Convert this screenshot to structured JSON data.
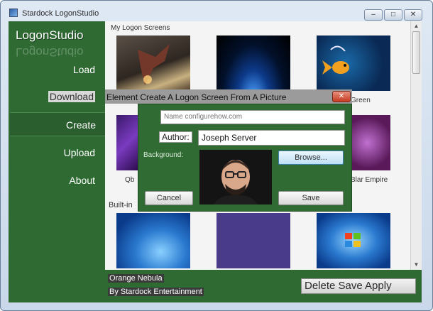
{
  "window": {
    "title": "Stardock LogonStudio",
    "controls": {
      "minimize": "–",
      "maximize": "□",
      "close": "✕"
    }
  },
  "sidebar": {
    "brand": "LogonStudio",
    "items": [
      {
        "label": "Load"
      },
      {
        "label": "Download"
      },
      {
        "label": "Create"
      },
      {
        "label": "Upload"
      },
      {
        "label": "About"
      }
    ]
  },
  "main": {
    "my_screens_label": "My Logon Screens",
    "built_in_label": "Built-in",
    "captions": {
      "green": "Green",
      "qbyte": "Qb",
      "empire": "Blar Empire"
    }
  },
  "bottom": {
    "theme_name": "Orange Nebula",
    "theme_author": "By Stardock Entertainment",
    "actions": "Delete Save Apply"
  },
  "dialog": {
    "title": "Element Create A Logon Screen From A Picture",
    "close": "✕",
    "name_placeholder": "Name configurehow.com",
    "author_label": "Author:",
    "author_value": "Joseph Server",
    "background_label": "Background:",
    "browse_label": "Browse...",
    "cancel_label": "Cancel",
    "save_label": "Save"
  },
  "colors": {
    "sidebar_green": "#2e6a32",
    "dialog_green": "#2f6b33",
    "close_red": "#c43b20"
  }
}
